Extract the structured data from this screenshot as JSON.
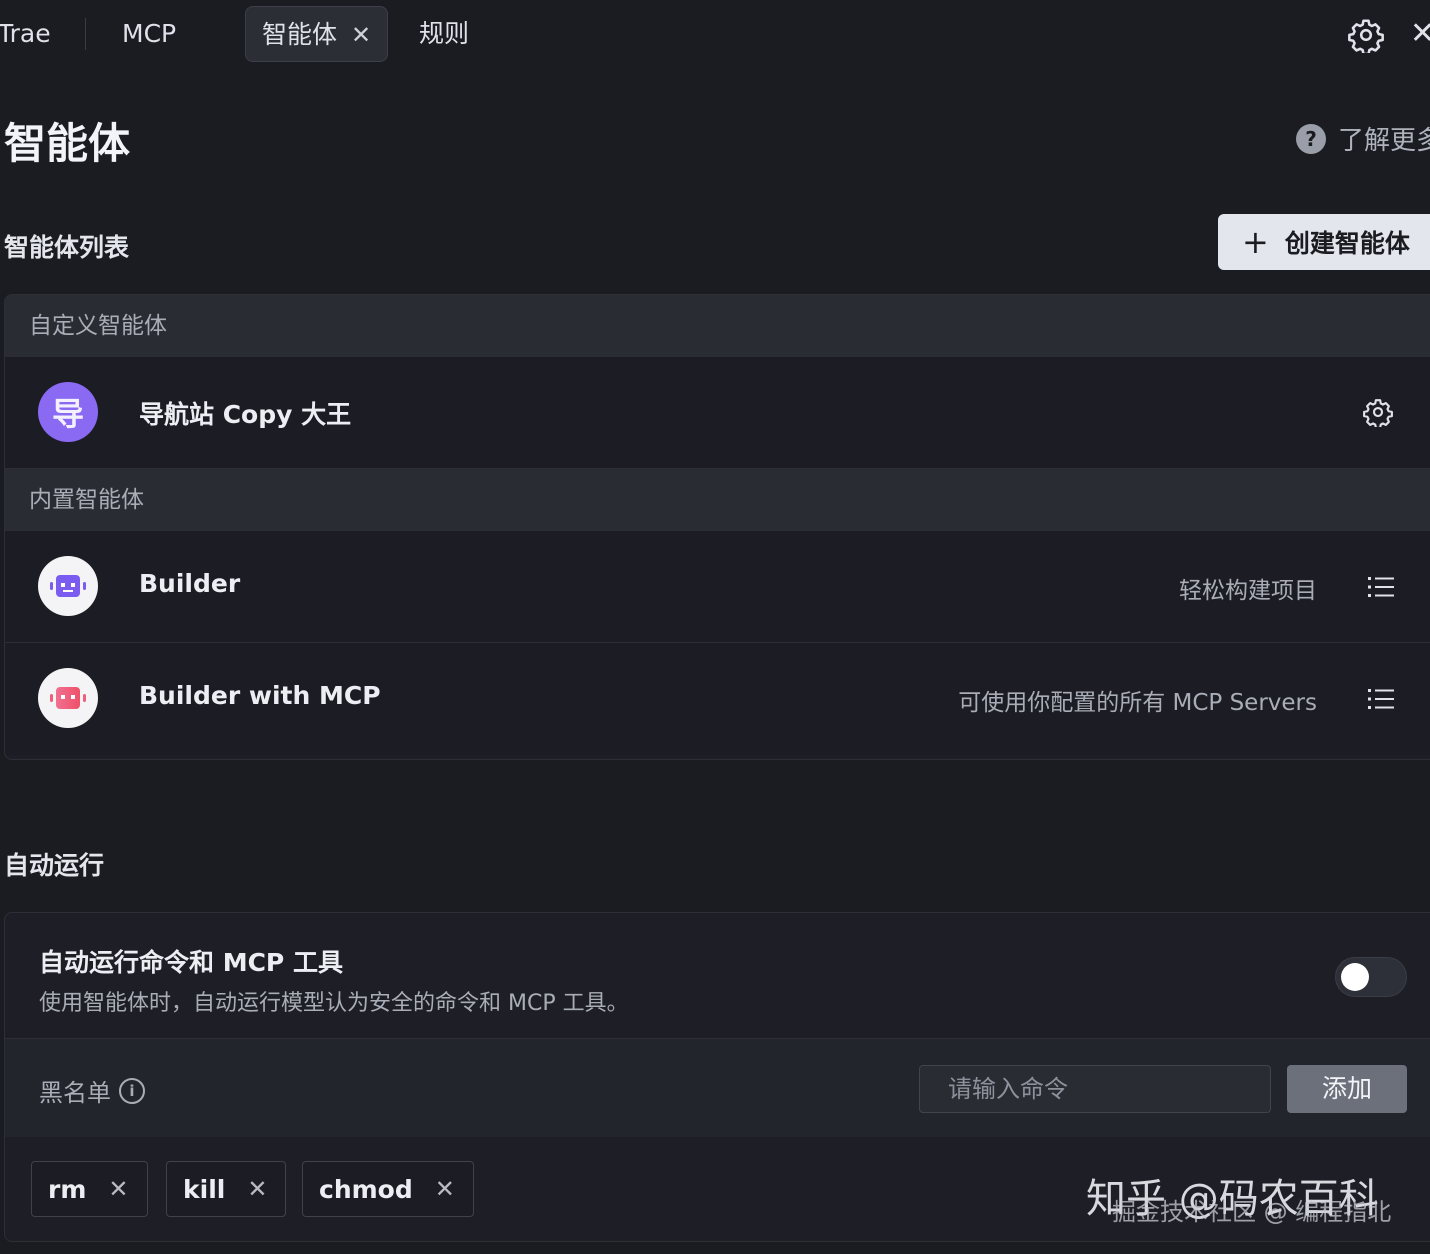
{
  "tabs": [
    {
      "label": "Trae"
    },
    {
      "label": "MCP"
    },
    {
      "label": "智能体",
      "close": "✕",
      "active": true
    },
    {
      "label": "规则"
    }
  ],
  "window": {
    "close": "✕"
  },
  "page": {
    "title": "智能体",
    "help_glyph": "?",
    "learn_more": "了解更多"
  },
  "agent_list": {
    "title": "智能体列表",
    "create_plus": "+",
    "create_label": "创建智能体",
    "custom_group": "自定义智能体",
    "builtin_group": "内置智能体",
    "custom_agents": [
      {
        "avatar": "导",
        "name": "导航站 Copy 大王",
        "action_icon": "gear-icon"
      }
    ],
    "builtin_agents": [
      {
        "name": "Builder",
        "description": "轻松构建项目",
        "action_icon": "list-icon",
        "avatar_color": "#7b5cf0"
      },
      {
        "name": "Builder with MCP",
        "description": "可使用你配置的所有 MCP Servers",
        "action_icon": "list-icon",
        "avatar_color": "#f0607a"
      }
    ]
  },
  "auto_run": {
    "title": "自动运行",
    "setting_title": "自动运行命令和 MCP 工具",
    "setting_desc": "使用智能体时，自动运行模型认为安全的命令和 MCP 工具。",
    "enabled": false,
    "blacklist_label": "黑名单",
    "info_glyph": "i",
    "input_placeholder": "请输入命令",
    "add_label": "添加",
    "chip_close": "✕",
    "commands": [
      "rm",
      "kill",
      "chmod"
    ]
  },
  "watermark": {
    "main": "知乎 @码农百科",
    "sub": "掘金技术社区 @ 编程指北"
  },
  "colors": {
    "background": "#1b1c22",
    "panel": "#1e1f26",
    "accent_purple": "#8a6af2",
    "button_light": "#e3e6ec"
  }
}
